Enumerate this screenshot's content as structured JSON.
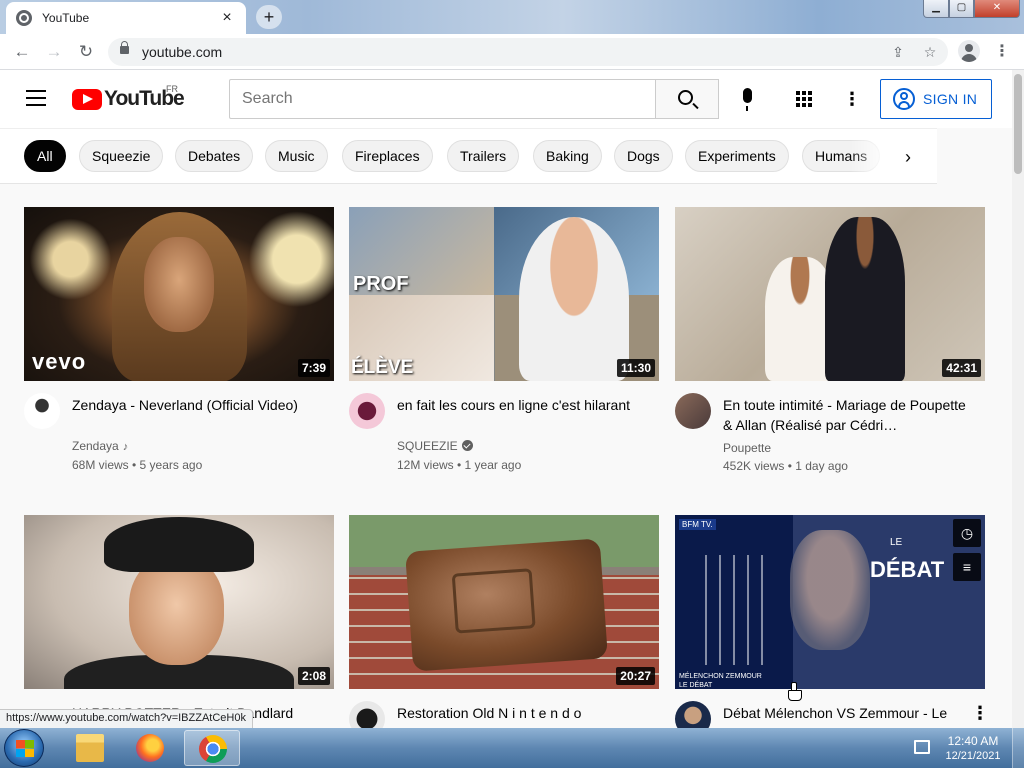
{
  "browser": {
    "tab_title": "YouTube",
    "tab_close": "×",
    "new_tab": "+",
    "url": "youtube.com",
    "status_url": "https://www.youtube.com/watch?v=IBZZAtCeH0k",
    "window_controls": {
      "minimize": "▁",
      "maximize": "▢",
      "close": "✕"
    },
    "nav": {
      "back": "←",
      "forward": "→",
      "reload": "↻"
    },
    "omnibox_icons": {
      "share": "⇪",
      "bookmark": "☆"
    },
    "menu": "⋮"
  },
  "header": {
    "logo_text": "YouTube",
    "region": "FR",
    "search_placeholder": "Search",
    "sign_in": "SIGN IN",
    "more": "⋮"
  },
  "chips": [
    "All",
    "Squeezie",
    "Debates",
    "Music",
    "Fireplaces",
    "Trailers",
    "Baking",
    "Dogs",
    "Experiments",
    "Humans"
  ],
  "chip_next": "›",
  "videos": [
    {
      "title": "Zendaya - Neverland (Official Video)",
      "channel": "Zendaya",
      "channel_suffix": "♪",
      "stats": "68M views • 5 years ago",
      "duration": "7:39",
      "thumb_label": "vevo"
    },
    {
      "title": "en fait les cours en ligne c'est hilarant",
      "channel": "SQUEEZIE",
      "stats": "12M views • 1 year ago",
      "duration": "11:30",
      "thumb_label_top": "PROF",
      "thumb_label_bottom": "ÉLÈVE"
    },
    {
      "title": "En toute intimité - Mariage de Poupette & Allan (Réalisé par Cédri…",
      "channel": "Poupette",
      "stats": "452K views • 1 day ago",
      "duration": "42:31"
    },
    {
      "title": "HARRY POTTER - Extrait Bandlard",
      "duration": "2:08"
    },
    {
      "title": "Restoration Old N i n t e n d o",
      "duration": "20:27"
    },
    {
      "title": "Débat Mélenchon VS Zemmour - Le",
      "thumb_top": "LE",
      "thumb_main": "DÉBAT",
      "thumb_caption": "BFM TV.",
      "thumb_caption_names": "MÉLENCHON ZEMMOUR",
      "thumb_caption_show": "LE DÉBAT",
      "clock_icon": "◷",
      "queue_icon": "≡",
      "kebab": "⋮"
    }
  ],
  "taskbar": {
    "time": "12:40 AM",
    "date": "12/21/2021"
  }
}
